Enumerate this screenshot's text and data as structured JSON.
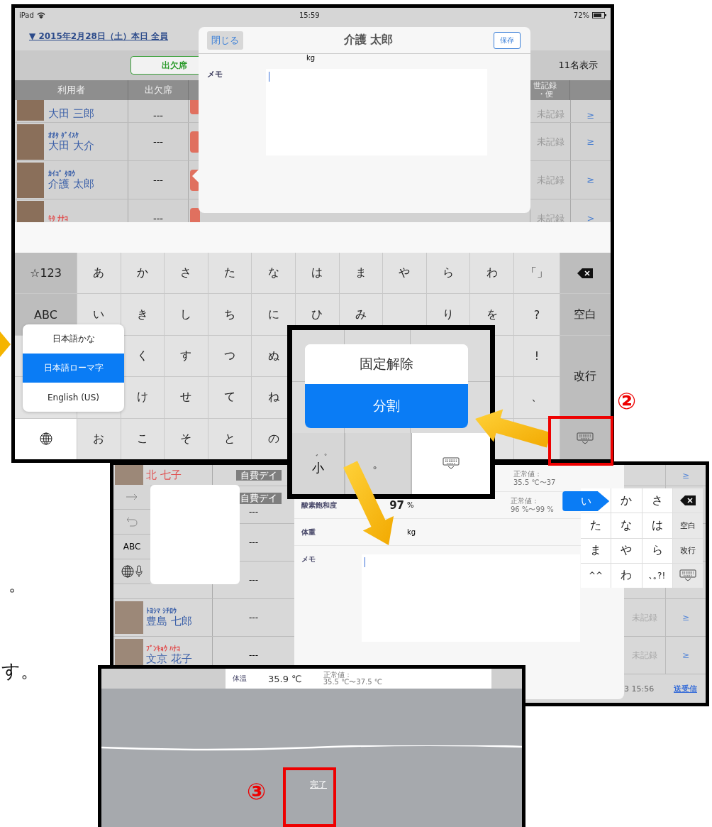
{
  "main_screen": {
    "status_bar": {
      "device": "iPad",
      "time": "15:59",
      "battery": "72%"
    },
    "date_filter": "▼ 2015年2月28日（土）本日 全員",
    "attendance_filter": "出欠席",
    "count": "11名表示",
    "columns": [
      {
        "lines": [
          "利用者"
        ]
      },
      {
        "lines": [
          "出欠席"
        ]
      },
      {
        "lines": [
          "世記録",
          "・便"
        ]
      }
    ],
    "rows": [
      {
        "name": "大田 三郎",
        "color": "#3a5fa8",
        "attendance": "---",
        "record": "未記録",
        "link": "≥"
      },
      {
        "kana": "ｵｵﾀ ﾀﾞｲｽｹ",
        "name": "大田 大介",
        "color": "#3a5fa8",
        "attendance": "---",
        "record": "未記録",
        "link": "≥"
      },
      {
        "kana": "ｶｲｺﾞ ﾀﾛｳ",
        "name": "介護 太郎",
        "color": "#3a5fa8",
        "attendance": "---",
        "record": "未記録",
        "link": "≥"
      },
      {
        "kana": "ｷﾀ ﾅﾅｺ",
        "color": "#e05050",
        "attendance": "---",
        "record": "未記録",
        "link": ">"
      }
    ],
    "modal": {
      "close": "閉じる",
      "title": "介護 太郎",
      "save": "保存",
      "unit": "kg",
      "memo_label": "メモ"
    },
    "keyboard": [
      [
        {
          "kind": "function",
          "label": "☆123"
        },
        {
          "kind": "char",
          "label": "あ"
        },
        {
          "kind": "char",
          "label": "か"
        },
        {
          "kind": "char",
          "label": "さ"
        },
        {
          "kind": "char",
          "label": "た"
        },
        {
          "kind": "char",
          "label": "な"
        },
        {
          "kind": "char",
          "label": "は"
        },
        {
          "kind": "char",
          "label": "ま"
        },
        {
          "kind": "char",
          "label": "や"
        },
        {
          "kind": "char",
          "label": "ら"
        },
        {
          "kind": "char",
          "label": "わ"
        },
        {
          "kind": "char",
          "label": "「」"
        },
        {
          "kind": "delete"
        }
      ],
      [
        {
          "kind": "function",
          "label": "ABC"
        },
        {
          "kind": "char",
          "label": "い"
        },
        {
          "kind": "char",
          "label": "き"
        },
        {
          "kind": "char",
          "label": "し"
        },
        {
          "kind": "char",
          "label": "ち"
        },
        {
          "kind": "char",
          "label": "に"
        },
        {
          "kind": "char",
          "label": "ひ"
        },
        {
          "kind": "char",
          "label": "み"
        },
        {
          "kind": "blank"
        },
        {
          "kind": "char",
          "label": "り"
        },
        {
          "kind": "char",
          "label": "を"
        },
        {
          "kind": "char",
          "label": "?"
        },
        {
          "kind": "function",
          "label": "空白"
        }
      ],
      [
        {
          "kind": "blank"
        },
        {
          "kind": "blank"
        },
        {
          "kind": "char",
          "label": "く"
        },
        {
          "kind": "char",
          "label": "す"
        },
        {
          "kind": "char",
          "label": "つ"
        },
        {
          "kind": "char",
          "label": "ぬ"
        },
        {
          "kind": "blank"
        },
        {
          "kind": "blank"
        },
        {
          "kind": "blank"
        },
        {
          "kind": "blank"
        },
        {
          "kind": "blank"
        },
        {
          "kind": "char",
          "label": "!"
        },
        {
          "kind": "tall",
          "label": "改行"
        }
      ],
      [
        {
          "kind": "blank"
        },
        {
          "kind": "blank"
        },
        {
          "kind": "char",
          "label": "け"
        },
        {
          "kind": "char",
          "label": "せ"
        },
        {
          "kind": "char",
          "label": "て"
        },
        {
          "kind": "char",
          "label": "ね"
        },
        {
          "kind": "blank"
        },
        {
          "kind": "blank"
        },
        {
          "kind": "blank"
        },
        {
          "kind": "blank"
        },
        {
          "kind": "blank"
        },
        {
          "kind": "char",
          "label": "、"
        }
      ],
      [
        {
          "kind": "globe"
        },
        {
          "kind": "char",
          "label": "お"
        },
        {
          "kind": "char",
          "label": "こ"
        },
        {
          "kind": "char",
          "label": "そ"
        },
        {
          "kind": "char",
          "label": "と"
        },
        {
          "kind": "char",
          "label": "の"
        },
        {
          "kind": "blank"
        },
        {
          "kind": "blank"
        },
        {
          "kind": "blank"
        },
        {
          "kind": "blank"
        },
        {
          "kind": "blank"
        },
        {
          "kind": "blank"
        },
        {
          "kind": "hide"
        }
      ]
    ],
    "language_menu": [
      {
        "label": "日本語かな",
        "selected": false
      },
      {
        "label": "日本語ローマ字",
        "selected": true
      },
      {
        "label": "English (US)",
        "selected": false
      }
    ]
  },
  "callout_2": "②",
  "split_menu": {
    "items": [
      {
        "label": "固定解除",
        "selected": false
      },
      {
        "label": "分割",
        "selected": true
      }
    ],
    "keys": [
      {
        "kind": "char",
        "label": "小",
        "mark": "゛゜"
      },
      {
        "kind": "char",
        "label": "。"
      },
      {
        "kind": "hide"
      }
    ]
  },
  "split_screen": {
    "rows": [
      {
        "name": "北 七子",
        "color": "#e05050",
        "tag": "自費デイ",
        "link": "≥"
      },
      {
        "tag": "自費デイ",
        "attendance": "---"
      },
      {
        "attendance": "---"
      },
      {
        "attendance": "---"
      },
      {
        "kana": "ﾄﾖｼﾏ ｼﾁﾛｳ",
        "name": "豊島 七郎",
        "color": "#3a5fa8",
        "attendance": "---",
        "record": "未記録",
        "link": "≥"
      },
      {
        "kana": "ﾌﾞﾝｷｮｳ ﾊﾅｺ",
        "name": "文京 花子",
        "color": "#e05050",
        "attendance": "---",
        "record": "未記録",
        "link": "≥"
      }
    ],
    "form": [
      {
        "normal": [
          "正常値：",
          "35.5 ℃〜37"
        ]
      },
      {
        "label": "酸素飽和度",
        "value": "97",
        "unit": "%",
        "normal": [
          "正常値：",
          "96 %〜99 %"
        ]
      },
      {
        "label": "体重",
        "unit": "kg"
      }
    ],
    "memo_label": "メモ",
    "side_keys": [
      {
        "kind": "arrow"
      },
      {
        "kind": "undo"
      },
      {
        "kind": "text",
        "label": "ABC"
      },
      {
        "kind": "globe-mic"
      }
    ],
    "kana_keys": [
      [
        {
          "kind": "bubble",
          "label": "い"
        },
        {
          "kind": "char",
          "label": "か"
        },
        {
          "kind": "char",
          "label": "さ"
        },
        {
          "kind": "delete"
        }
      ],
      [
        {
          "kind": "char",
          "label": "た"
        },
        {
          "kind": "char",
          "label": "な"
        },
        {
          "kind": "char",
          "label": "は"
        },
        {
          "kind": "function",
          "label": "空白"
        }
      ],
      [
        {
          "kind": "char",
          "label": "ま"
        },
        {
          "kind": "char",
          "label": "や"
        },
        {
          "kind": "char",
          "label": "ら"
        },
        {
          "kind": "function",
          "label": "改行"
        }
      ],
      [
        {
          "kind": "char",
          "label": "^^"
        },
        {
          "kind": "char",
          "label": "わ"
        },
        {
          "kind": "char",
          "label": "､｡?!"
        },
        {
          "kind": "hide"
        }
      ]
    ],
    "sync_time": "3 15:56",
    "sync": "送受信"
  },
  "dictation_screen": {
    "field": {
      "label": "体温",
      "value": "35.9",
      "unit": "℃",
      "normal": [
        "正常値：",
        "35.5 ℃〜37.5 ℃"
      ]
    },
    "done": "完了",
    "callout": "③"
  },
  "page_text": [
    "。",
    "す。"
  ]
}
